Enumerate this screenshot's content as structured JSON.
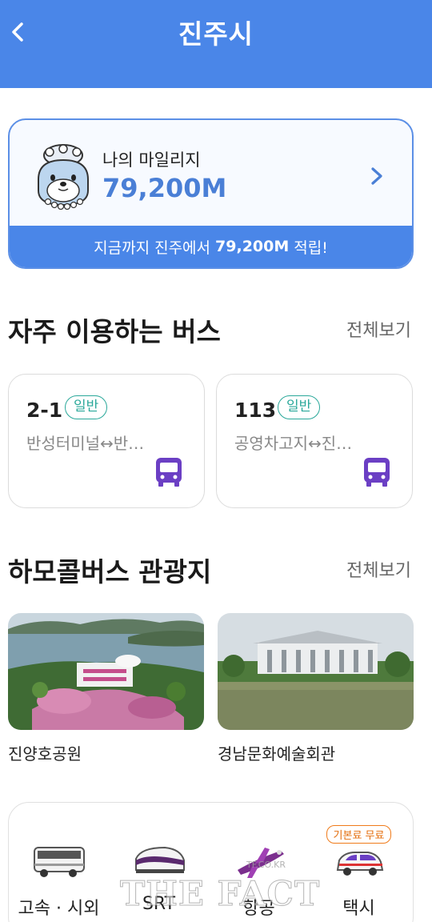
{
  "header": {
    "title": "진주시",
    "back_icon": "chevron-left-icon"
  },
  "mileage": {
    "label": "나의 마일리지",
    "value": "79,200M",
    "footer_prefix": "지금까지 진주에서",
    "footer_amount": "79,200M",
    "footer_suffix": "적립!"
  },
  "frequent_bus": {
    "title": "자주 이용하는 버스",
    "see_all": "전체보기",
    "cards": [
      {
        "number": "2-1",
        "badge": "일반",
        "route": "반성터미널↔반…"
      },
      {
        "number": "113",
        "badge": "일반",
        "route": "공영차고지↔진…"
      }
    ]
  },
  "tour": {
    "title": "하모콜버스 관광지",
    "see_all": "전체보기",
    "spots": [
      {
        "name": "진양호공원"
      },
      {
        "name": "경남문화예술회관"
      }
    ]
  },
  "transport": {
    "items": [
      {
        "label": "고속 · 시외",
        "icon": "express-bus-icon"
      },
      {
        "label": "SRT",
        "icon": "srt-train-icon"
      },
      {
        "label": "항공",
        "icon": "airplane-icon"
      },
      {
        "label": "택시",
        "icon": "taxi-icon",
        "badge": "기본료 무료"
      }
    ]
  },
  "watermark": {
    "text": "THE FACT",
    "sub": "TF.CO.KR"
  },
  "colors": {
    "primary": "#4a86e8",
    "badge_teal": "#2aa89a",
    "bus_purple": "#6b3fc4",
    "taxi_badge_orange": "#f07b1a"
  }
}
